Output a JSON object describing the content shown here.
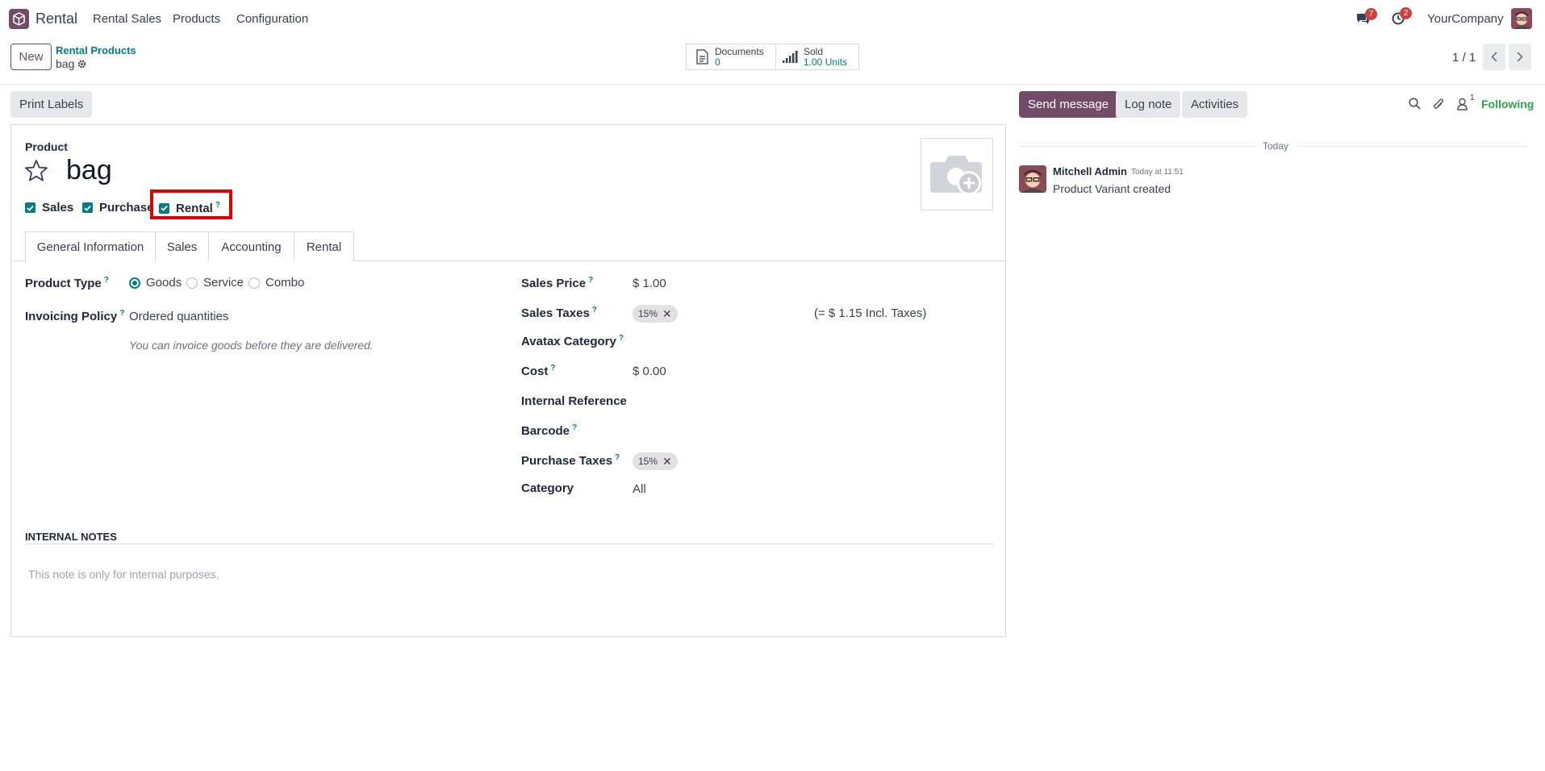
{
  "navbar": {
    "app_name": "Rental",
    "menus": [
      "Rental Sales",
      "Products",
      "Configuration"
    ],
    "messages_count": "7",
    "activities_count": "2",
    "company": "YourCompany"
  },
  "control_panel": {
    "new_label": "New",
    "breadcrumb_parent": "Rental Products",
    "breadcrumb_current": "bag",
    "stat_documents_label": "Documents",
    "stat_documents_value": "0",
    "stat_sold_label": "Sold",
    "stat_sold_value": "1.00 Units",
    "pager": "1 / 1"
  },
  "form": {
    "print_labels": "Print Labels",
    "product_label": "Product",
    "product_name": "bag",
    "checkboxes": {
      "sales": "Sales",
      "purchase": "Purchase",
      "rental": "Rental"
    },
    "tabs": [
      "General Information",
      "Sales",
      "Accounting",
      "Rental"
    ],
    "left": {
      "product_type_label": "Product Type",
      "product_type_options": [
        "Goods",
        "Service",
        "Combo"
      ],
      "invoicing_policy_label": "Invoicing Policy",
      "invoicing_policy_value": "Ordered quantities",
      "invoicing_hint": "You can invoice goods before they are delivered."
    },
    "right": {
      "sales_price_label": "Sales Price",
      "sales_price_value": "$ 1.00",
      "sales_taxes_label": "Sales Taxes",
      "sales_taxes_tag": "15%",
      "sales_taxes_incl": "(= $ 1.15 Incl. Taxes)",
      "avatax_label": "Avatax Category",
      "cost_label": "Cost",
      "cost_value": "$ 0.00",
      "internal_ref_label": "Internal Reference",
      "barcode_label": "Barcode",
      "purchase_taxes_label": "Purchase Taxes",
      "purchase_taxes_tag": "15%",
      "category_label": "Category",
      "category_value": "All"
    },
    "notes_title": "INTERNAL NOTES",
    "notes_placeholder": "This note is only for internal purposes."
  },
  "chatter": {
    "send_message": "Send message",
    "log_note": "Log note",
    "activities": "Activities",
    "followers_count": "1",
    "following": "Following",
    "date_separator": "Today",
    "author": "Mitchell Admin",
    "time": "Today at 11:51",
    "message": "Product Variant created"
  },
  "colors": {
    "brand": "#714b67",
    "accent": "#017e84",
    "highlight_box": "#e00000"
  }
}
